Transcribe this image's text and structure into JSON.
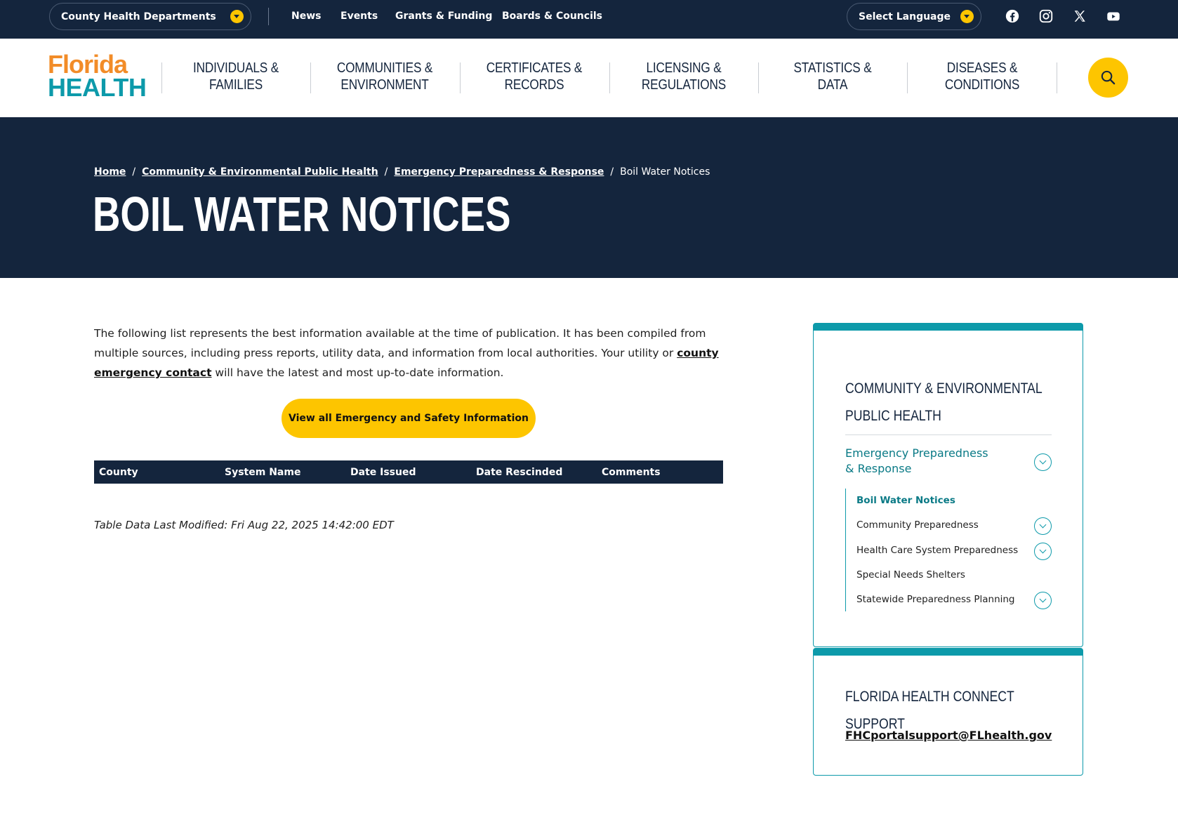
{
  "utility": {
    "county_dropdown": "County Health Departments",
    "links": [
      "News",
      "Events",
      "Grants & Funding",
      "Boards & Councils"
    ],
    "language": "Select Language",
    "social_icons": [
      "facebook-icon",
      "instagram-icon",
      "x-icon",
      "youtube-icon"
    ]
  },
  "logo": {
    "line1": "Florida",
    "line2": "HEALTH"
  },
  "nav": {
    "items": [
      {
        "line1": "INDIVIDUALS &",
        "line2": "FAMILIES"
      },
      {
        "line1": "COMMUNITIES &",
        "line2": "ENVIRONMENT"
      },
      {
        "line1": "CERTIFICATES &",
        "line2": "RECORDS"
      },
      {
        "line1": "LICENSING &",
        "line2": "REGULATIONS"
      },
      {
        "line1": "STATISTICS &",
        "line2": "DATA"
      },
      {
        "line1": "DISEASES &",
        "line2": "CONDITIONS"
      }
    ]
  },
  "breadcrumb": {
    "items": [
      "Home",
      "Community & Environmental Public Health",
      "Emergency Preparedness & Response"
    ],
    "current": "Boil Water Notices",
    "separator": "/"
  },
  "page_title": "BOIL WATER NOTICES",
  "intro": {
    "text1": "The following list represents the best information available at the time of publication. It has been compiled from multiple sources, including press reports, utility data, and information from local authorities. Your utility or ",
    "link": "county emergency contact",
    "text2": " will have the latest and most up-to-date information."
  },
  "cta_label": "View all Emergency and Safety Information",
  "table": {
    "columns": [
      "County",
      "System Name",
      "Date Issued",
      "Date Rescinded",
      "Comments"
    ],
    "rows": []
  },
  "last_modified": "Table Data Last Modified: Fri Aug 22, 2025 14:42:00 EDT",
  "sidebar": {
    "title": "COMMUNITY & ENVIRONMENTAL PUBLIC HEALTH",
    "parent": "Emergency Preparedness & Response",
    "items": [
      {
        "label": "Boil Water Notices",
        "active": true,
        "expandable": false
      },
      {
        "label": "Community Preparedness",
        "active": false,
        "expandable": true
      },
      {
        "label": "Health Care System Preparedness",
        "active": false,
        "expandable": true
      },
      {
        "label": "Special Needs Shelters",
        "active": false,
        "expandable": false
      },
      {
        "label": "Statewide Preparedness Planning",
        "active": false,
        "expandable": true
      }
    ]
  },
  "support": {
    "title": "FLORIDA HEALTH CONNECT SUPPORT",
    "email": "FHCportalsupport@FLhealth.gov"
  },
  "colors": {
    "navy": "#14253d",
    "gold": "#fdc500",
    "teal": "#0d9aaa",
    "orange": "#f28c28"
  }
}
